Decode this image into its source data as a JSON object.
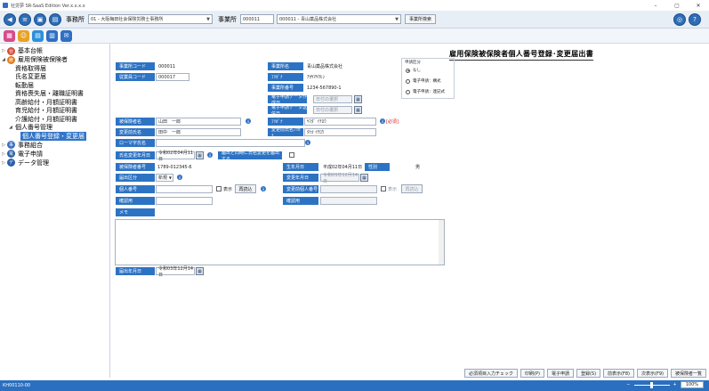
{
  "app": {
    "title": "社労夢 SR-SaaS Edition Ver.x.x.x.x"
  },
  "window": {
    "minimize": "–",
    "maximize": "▢",
    "close": "✕"
  },
  "toolbar": {
    "office_label": "事務所",
    "office_value": "01 - 大阪梅田社会保険労務士事務所",
    "site_label": "事業所",
    "site_code": "000011",
    "site_name": "000011 - 青山薬品株式会社",
    "site_search": "事業所検索"
  },
  "sidebar": {
    "nodes": [
      {
        "label": "基本台帳",
        "color": "#d64b3a"
      },
      {
        "label": "雇用保険被保険者",
        "color": "#e07a1f"
      },
      {
        "label": "事務組合",
        "color": "#3a6fc4"
      },
      {
        "label": "電子申請",
        "color": "#2b5ea8"
      },
      {
        "label": "データ管理",
        "color": "#2b5ea8"
      }
    ],
    "children": [
      "資格取得届",
      "氏名変更届",
      "転勤届",
      "資格喪失届・離職証明書",
      "高齢給付・月額証明書",
      "育児給付・月額証明書",
      "介護給付・月額証明書"
    ],
    "sub_parent": "個人番号管理",
    "sub_selected": "個人番号登録・変更届"
  },
  "form": {
    "title": "雇用保険被保険者個人番号登録･変更届出書",
    "office_code_label": "事業所コード",
    "office_code": "000011",
    "office_name_label": "事業所名",
    "office_name": "青山薬品株式会社",
    "office_kana_label": "ﾌﾘｶﾞﾅ",
    "office_kana": "ｱｵﾔﾏﾔｸﾋﾝ",
    "office_no_label": "事業所番号",
    "office_no": "1234-567890-1",
    "emp_code_label": "従業員コード",
    "emp_code": "000017",
    "req_created_label": "電子申請データ作成日",
    "req_created": "日付の選択",
    "req_sent_label": "電子申請データ送信日",
    "req_sent": "日付の選択",
    "group_label": "申請区分",
    "radio1": "なし",
    "radio2": "電子申請：構式",
    "radio3": "電子申請：連記式",
    "insured_name_label": "被保険者名",
    "insured_name": "山田　一郎",
    "kana_label": "ﾌﾘｶﾞﾅ",
    "kana_value": "ﾔﾏﾀﾞ ｲﾁﾛｳ",
    "required_note": "[必須]",
    "prev_name_label": "変更前氏名",
    "prev_name": "田中　一郎",
    "prev_kana_label": "変更前氏名ﾌﾘｶﾞﾅ",
    "prev_kana": "ﾀﾅｶ ｲﾁﾛｳ",
    "roman_label": "ローマ字氏名",
    "roman_value": "",
    "birth_change_label": "氏名変更年月日",
    "birth_change": "令和02年04月11日",
    "simul_label": "届出と同時に氏名変更を届出する",
    "insured_no_label": "被保険者番号",
    "insured_no": "1789-012345-6",
    "dob_label": "生年月日",
    "dob": "平成02年04月11日",
    "gender_label": "性別",
    "gender": "男",
    "report_type_label": "届出区分",
    "report_type": "新規",
    "change_date_label": "変更年月日",
    "change_date": "令和03年12月14日",
    "my_number_label": "個人番号",
    "my_number": "",
    "show_label": "表示",
    "reload_btn": "再読込",
    "changed_no_label": "変更前個人番号",
    "changed_no": "",
    "show_label2": "表示",
    "reload_btn2": "再読込",
    "confirm_label": "確認用",
    "confirm_label2": "確認用",
    "memo_label": "メモ",
    "report_date_label": "届出年月日",
    "report_date": "令和03年12月14日"
  },
  "actions": [
    "必須項目入力チェック",
    "印刷(P)",
    "電子申請",
    "登録(S)",
    "前表示(F8)",
    "次表示(F9)",
    "被保険者一覧"
  ],
  "status": {
    "code": "KH00110-00",
    "zoom": "100%"
  }
}
